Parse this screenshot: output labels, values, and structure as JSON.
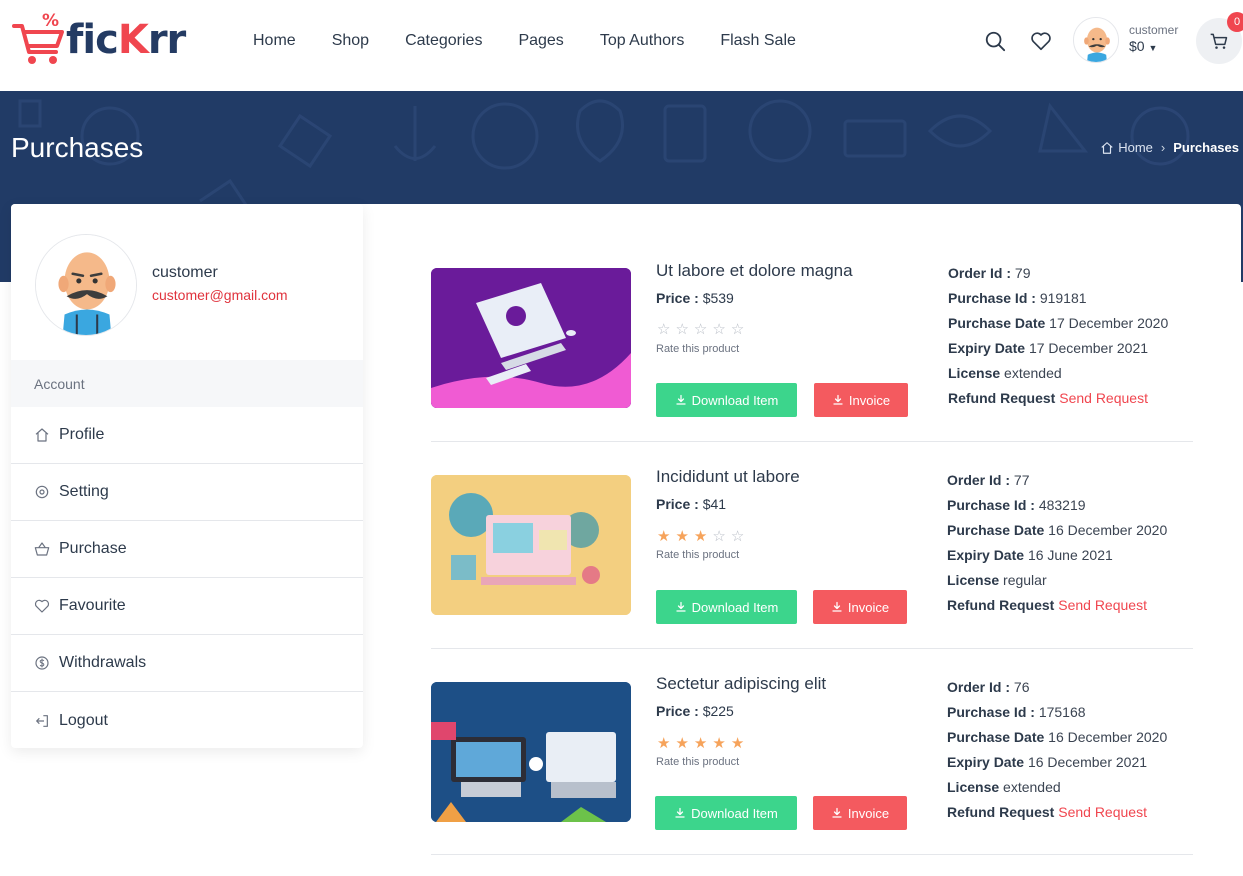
{
  "header": {
    "logo": {
      "prefix": "fic",
      "accent": "K",
      "suffix": "rr",
      "badge": "%"
    },
    "nav": [
      "Home",
      "Shop",
      "Categories",
      "Pages",
      "Top Authors",
      "Flash Sale"
    ],
    "user": {
      "name": "customer",
      "balance": "$0"
    },
    "cart_count": "0"
  },
  "banner": {
    "title": "Purchases",
    "breadcrumb": {
      "home": "Home",
      "current": "Purchases"
    }
  },
  "sidebar": {
    "name": "customer",
    "email": "customer@gmail.com",
    "section": "Account",
    "items": [
      {
        "label": "Profile",
        "icon": "home-icon"
      },
      {
        "label": "Setting",
        "icon": "gear-icon"
      },
      {
        "label": "Purchase",
        "icon": "basket-icon"
      },
      {
        "label": "Favourite",
        "icon": "heart-icon"
      },
      {
        "label": "Withdrawals",
        "icon": "money-icon"
      },
      {
        "label": "Logout",
        "icon": "logout-icon"
      }
    ]
  },
  "labels": {
    "price": "Price :",
    "rate": "Rate this product",
    "download": "Download Item",
    "invoice": "Invoice",
    "order_id": "Order Id :",
    "purchase_id": "Purchase Id :",
    "purchase_date": "Purchase Date",
    "expiry_date": "Expiry Date",
    "license": "License",
    "refund": "Refund Request",
    "send_request": "Send Request"
  },
  "purchases": [
    {
      "title": "Ut labore et dolore magna",
      "price": "$539",
      "rating": 0,
      "order_id": "79",
      "purchase_id": "919181",
      "purchase_date": "17 December 2020",
      "expiry_date": "17 December 2021",
      "license": "extended"
    },
    {
      "title": "Incididunt ut labore",
      "price": "$41",
      "rating": 3,
      "order_id": "77",
      "purchase_id": "483219",
      "purchase_date": "16 December 2020",
      "expiry_date": "16 June 2021",
      "license": "regular"
    },
    {
      "title": "Sectetur adipiscing elit",
      "price": "$225",
      "rating": 5,
      "order_id": "76",
      "purchase_id": "175168",
      "purchase_date": "16 December 2020",
      "expiry_date": "16 December 2021",
      "license": "extended"
    }
  ],
  "colors": {
    "brand_navy": "#213b66",
    "brand_red": "#f0464f",
    "download_green": "#3cd58c",
    "invoice_red": "#f45a5f",
    "star": "#f6a35b"
  }
}
